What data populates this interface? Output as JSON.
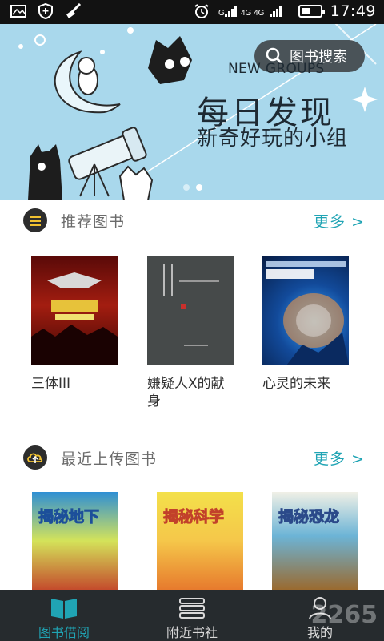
{
  "status_bar": {
    "network": "4G 4G",
    "time": "17:49"
  },
  "banner": {
    "search_label": "图书搜索",
    "eyebrow": "NEW GROUPS",
    "title": "每日发现",
    "subtitle": "新奇好玩的小组",
    "page_indicator": {
      "count": 2,
      "active": 2
    }
  },
  "recommended": {
    "title": "推荐图书",
    "more_label": "更多 >",
    "books": [
      {
        "title": "三体III"
      },
      {
        "title": "嫌疑人X的献身"
      },
      {
        "title": "心灵的未来"
      }
    ]
  },
  "recent": {
    "title": "最近上传图书",
    "more_label": "更多 >",
    "books": [
      {
        "cover_text": "揭秘地下"
      },
      {
        "cover_text": "揭秘科学"
      },
      {
        "cover_text": "揭秘恐龙"
      }
    ]
  },
  "bottom_nav": {
    "items": [
      {
        "label": "图书借阅",
        "icon": "open-book-icon",
        "active": true
      },
      {
        "label": "附近书社",
        "icon": "book-stack-icon",
        "active": false
      },
      {
        "label": "我的",
        "icon": "person-icon",
        "active": false
      }
    ]
  },
  "watermark": "2265",
  "colors": {
    "accent": "#20a4b4",
    "nav_bg": "#262b2e",
    "banner_bg": "#a9d8ec"
  }
}
